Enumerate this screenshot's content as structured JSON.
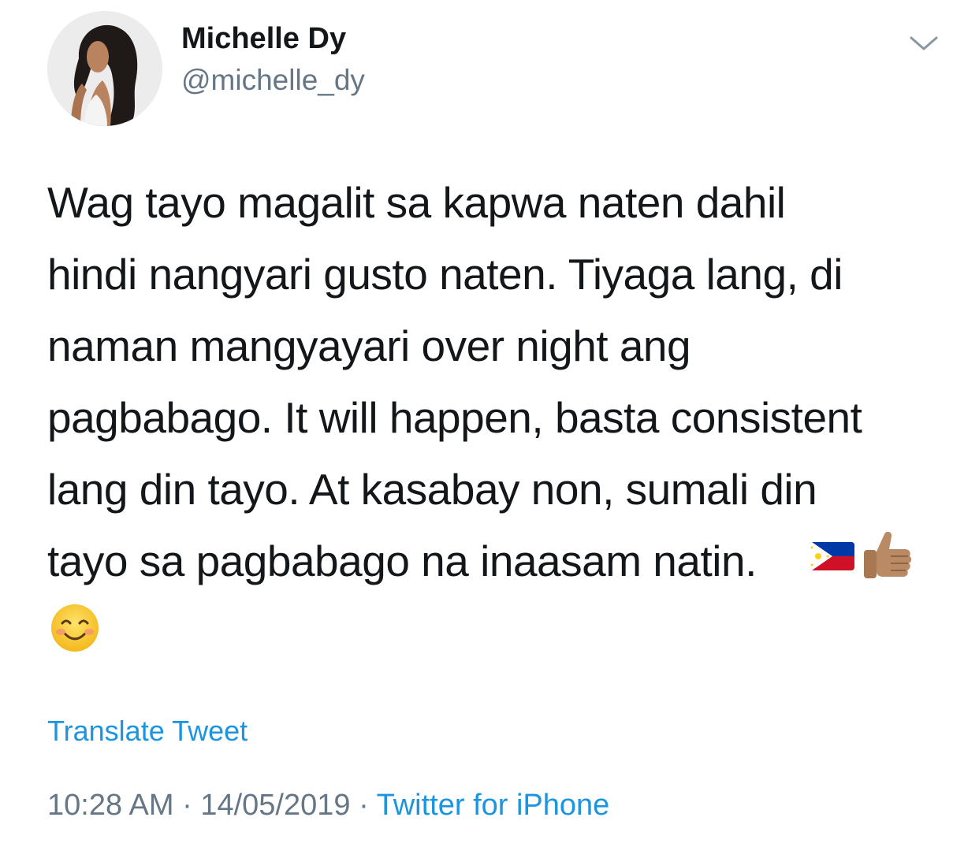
{
  "author": {
    "name": "Michelle Dy",
    "handle": "@michelle_dy"
  },
  "tweet": {
    "text": "Wag tayo magalit sa kapwa naten dahil\nhindi nangyari gusto naten. Tiyaga lang, di\nnaman mangyayari over night ang\npagbabago. It will happen, basta consistent\nlang din tayo. At kasabay non, sumali din\ntayo sa pagbabago na inaasam natin.",
    "emojis": [
      "philippines-flag-icon",
      "thumbs-up-icon",
      "smiling-face-icon"
    ]
  },
  "translate_label": "Translate Tweet",
  "meta": {
    "time": "10:28 AM",
    "separator": "·",
    "date": "14/05/2019",
    "source": "Twitter for iPhone"
  },
  "colors": {
    "link": "#1b95e0",
    "secondary_text": "#657786",
    "primary_text": "#14171a"
  }
}
